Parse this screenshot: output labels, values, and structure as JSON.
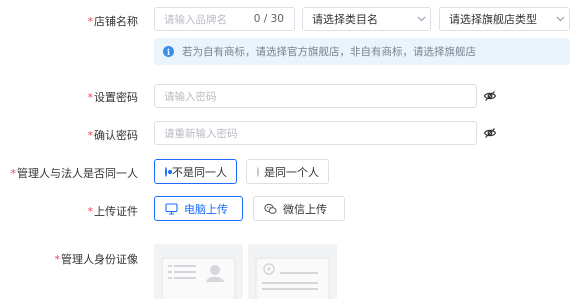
{
  "form": {
    "store_name": {
      "label": "店铺名称",
      "input_placeholder": "请输入品牌名",
      "char_count": "0 / 30",
      "category_select": "请选择类目名",
      "store_type_select": "请选择旗舰店类型"
    },
    "notice": {
      "text": "若为自有商标，请选择官方旗舰店，非自有商标，请选择旗舰店"
    },
    "password": {
      "label": "设置密码",
      "placeholder": "请输入密码"
    },
    "confirm_password": {
      "label": "确认密码",
      "placeholder": "请重新输入密码"
    },
    "same_person": {
      "label": "管理人与法人是否同一人",
      "options": [
        {
          "label": "不是同一人",
          "selected": true
        },
        {
          "label": "是同一个人",
          "selected": false
        }
      ]
    },
    "upload": {
      "label": "上传证件",
      "pc_button": "电脑上传",
      "wechat_button": "微信上传"
    },
    "id_photo": {
      "label": "管理人身份证像"
    }
  },
  "colors": {
    "accent": "#1a6dff",
    "required": "#e34d59",
    "notice_bg": "#e9f4fd",
    "info_icon": "#3a8ee6"
  }
}
